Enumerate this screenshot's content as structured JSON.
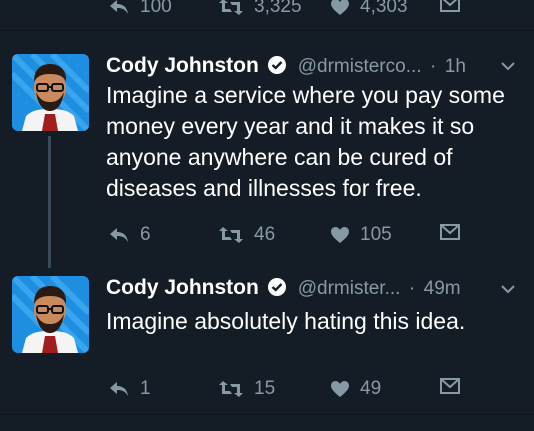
{
  "top_actions": {
    "replies": "100",
    "retweets": "3,325",
    "likes": "4,303"
  },
  "tweets": [
    {
      "name": "Cody Johnston",
      "handle": "@drmisterco...",
      "separator": "·",
      "time": "1h",
      "text": "Imagine a service where you pay some money every year and it makes it so anyone anywhere can be cured of diseases and illnesses for free.",
      "replies": "6",
      "retweets": "46",
      "likes": "105"
    },
    {
      "name": "Cody Johnston",
      "handle": "@drmister...",
      "separator": "·",
      "time": "49m",
      "text": "Imagine absolutely hating this idea.",
      "replies": "1",
      "retweets": "15",
      "likes": "49"
    }
  ],
  "colors": {
    "background": "#141d26",
    "muted": "#8899a6",
    "verified": "#ffffff",
    "avatar_bg": "#1e8fe0"
  },
  "icons": [
    "reply-icon",
    "retweet-icon",
    "like-icon",
    "dm-icon",
    "verified-icon",
    "chevron-down-icon"
  ]
}
